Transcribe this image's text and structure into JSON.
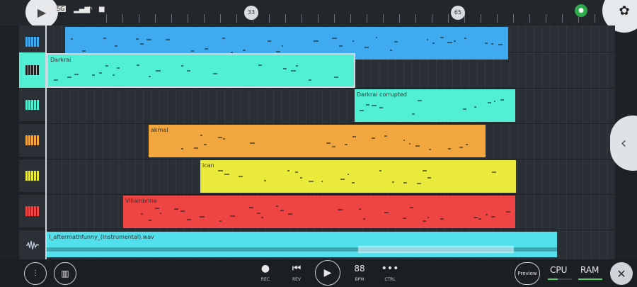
{
  "status_bar": {
    "network_label": "ВЫКЛ",
    "signal_label": "5G",
    "mic_indicator": "mic-icon"
  },
  "ruler": {
    "marker_a": "33",
    "marker_b": "65"
  },
  "tracks": [
    {
      "icon": "piano-roll-icon",
      "color": "#40aaf0"
    },
    {
      "icon": "piano-roll-icon",
      "color": "#222222"
    },
    {
      "icon": "piano-roll-icon",
      "color": "#51f0d4"
    },
    {
      "icon": "piano-roll-icon",
      "color": "#f2a640"
    },
    {
      "icon": "piano-roll-icon",
      "color": "#eaea3c"
    },
    {
      "icon": "piano-roll-icon",
      "color": "#ee4444"
    },
    {
      "icon": "waveform-icon",
      "color": "#c8d8e8"
    }
  ],
  "clips": [
    {
      "label": "",
      "color": "#40aaf0"
    },
    {
      "label": "Darkrai",
      "color": "#51f0d4"
    },
    {
      "label": "Darkrai corrupted",
      "color": "#51f0d4"
    },
    {
      "label": "akmal",
      "color": "#f2a640"
    },
    {
      "label": "ican",
      "color": "#eaea3c"
    },
    {
      "label": "Villainbrine",
      "color": "#ee4444"
    },
    {
      "label": "I_aftermathfunny_(Instrumental).wav",
      "color": "#51e0ec"
    }
  ],
  "toolbar": {
    "rec_label": "REC",
    "rev_label": "REV",
    "bpm_value": "88",
    "bpm_label": "BPM",
    "ctrl_label": "CTRL",
    "preview_label": "Preview",
    "cpu_label": "CPU",
    "ram_label": "RAM"
  },
  "colors": {
    "accent_green": "#5bd56a",
    "background": "#2a2f35"
  }
}
